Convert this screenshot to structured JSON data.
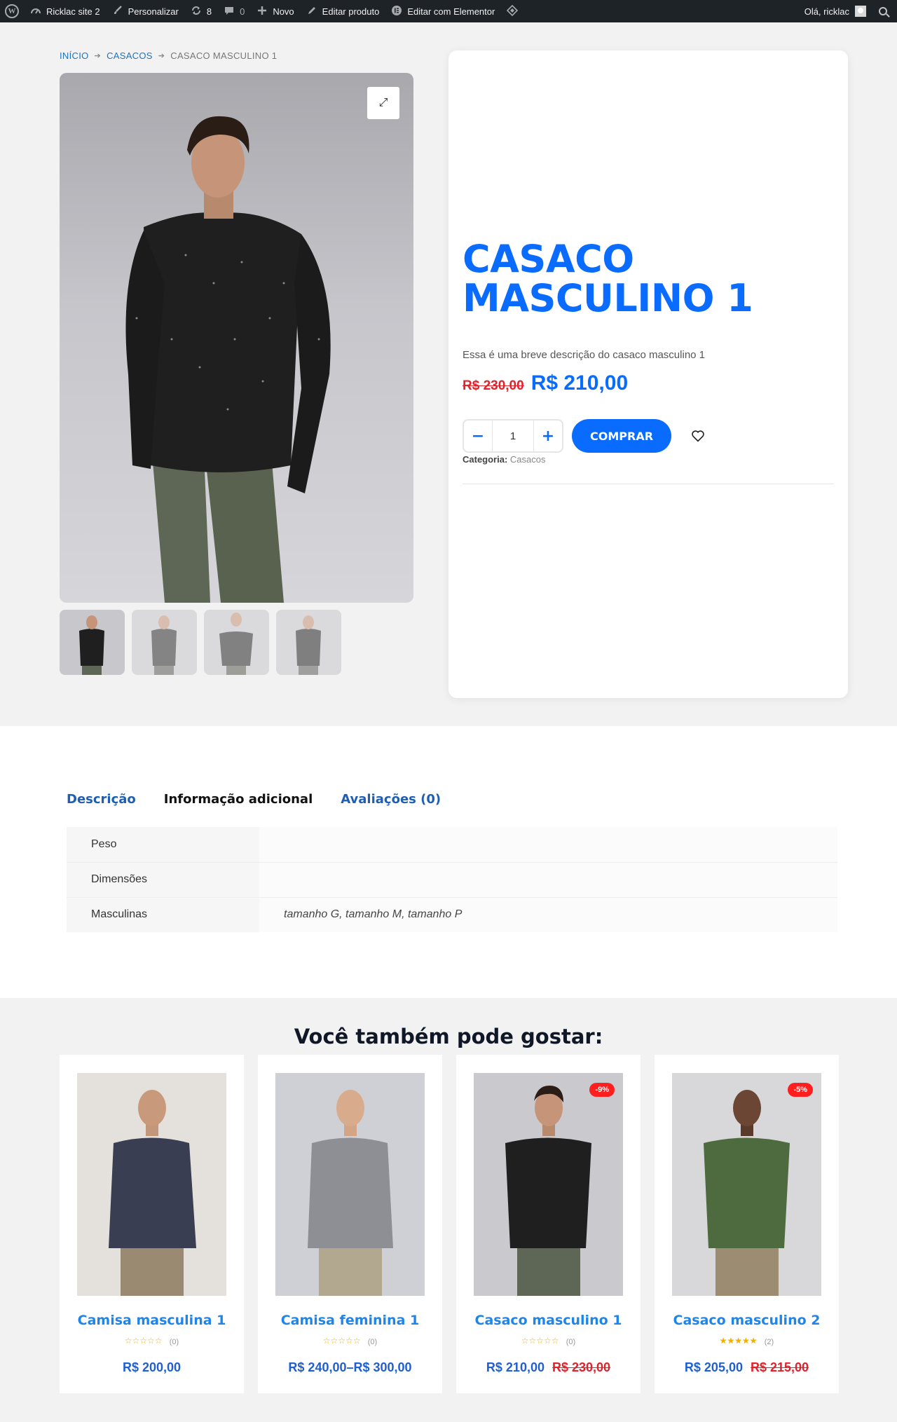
{
  "admin_bar": {
    "site_name": "Ricklac site 2",
    "customize": "Personalizar",
    "updates_count": "8",
    "comments_count": "0",
    "new": "Novo",
    "edit_product": "Editar produto",
    "edit_elementor": "Editar com Elementor",
    "greeting": "Olá, ricklac"
  },
  "breadcrumb": {
    "home": "INÍCIO",
    "category": "CASACOS",
    "current": "CASACO MASCULINO 1"
  },
  "product": {
    "title": "CASACO MASCULINO 1",
    "short_description": "Essa é uma breve descrição do casaco masculino 1",
    "old_price": "R$ 230,00",
    "price": "R$ 210,00",
    "quantity": "1",
    "buy_label": "COMPRAR",
    "category_label": "Categoria:",
    "category_value": "Casacos",
    "thumbnails": [
      {
        "label": "Foto 1",
        "shirt": "#1f1f1f",
        "pants": "#5e6656"
      },
      {
        "label": "Foto 2",
        "shirt": "#2b2b2b",
        "pants": "#5a5a55"
      },
      {
        "label": "Foto 3",
        "shirt": "#262626",
        "pants": "#595b50"
      },
      {
        "label": "Foto 4",
        "shirt": "#222222",
        "pants": "#5d5d58"
      }
    ]
  },
  "tabs": {
    "description": "Descrição",
    "additional": "Informação adicional",
    "reviews": "Avaliações (0)"
  },
  "attributes": [
    {
      "name": "Peso",
      "value": ""
    },
    {
      "name": "Dimensões",
      "value": ""
    },
    {
      "name": "Masculinas",
      "value": "tamanho G, tamanho M, tamanho P"
    }
  ],
  "related": {
    "title": "Você também pode gostar:",
    "items": [
      {
        "title": "Camisa masculina 1",
        "rating_count": "(0)",
        "rating": 0,
        "price": "R$ 200,00",
        "old_price": "",
        "badge": "",
        "bg": "#e4e1dc",
        "shirt": "#3a3e52",
        "pants": "#9a8a72"
      },
      {
        "title": "Camisa feminina 1",
        "rating_count": "(0)",
        "rating": 0,
        "price": "R$ 240,00–R$ 300,00",
        "old_price": "",
        "badge": "",
        "bg": "#cfd0d6",
        "shirt": "#8e8f94",
        "pants": "#b2a78f"
      },
      {
        "title": "Casaco masculino 1",
        "rating_count": "(0)",
        "rating": 0,
        "price": "R$ 210,00",
        "old_price": "R$ 230,00",
        "badge": "-9%",
        "bg": "#c9c9ce",
        "shirt": "#1f1f1f",
        "pants": "#5e6656"
      },
      {
        "title": "Casaco masculino 2",
        "rating_count": "(2)",
        "rating": 5,
        "price": "R$ 205,00",
        "old_price": "R$ 215,00",
        "badge": "-5%",
        "bg": "#d8d8da",
        "shirt": "#4e6a3f",
        "pants": "#9b8c72"
      }
    ]
  },
  "colors": {
    "accent": "#0a6bff",
    "sale": "#e2212a",
    "admin_bar": "#1d2327"
  }
}
